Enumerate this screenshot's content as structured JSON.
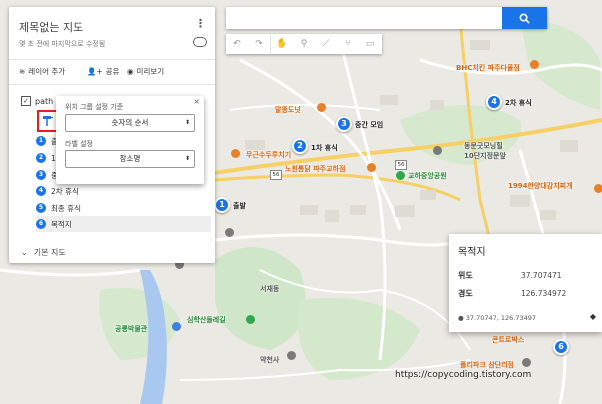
{
  "panel": {
    "title": "제목없는 지도",
    "subtitle": "몇 초 전에 마지막으로 수정됨",
    "add_layer": "레이어 추가",
    "share": "공유",
    "preview": "미리보기",
    "layer_name": "path",
    "items": [
      {
        "num": "1",
        "label": "출"
      },
      {
        "num": "2",
        "label": "1"
      },
      {
        "num": "3",
        "label": "중"
      },
      {
        "num": "4",
        "label": "2차 휴식"
      },
      {
        "num": "5",
        "label": "최종 휴식"
      },
      {
        "num": "6",
        "label": "목적지"
      }
    ],
    "base_map": "기본 지도"
  },
  "style_popup": {
    "group_label": "위치 그룹 설정 기준",
    "group_value": "숫자의 순서",
    "label_label": "라벨 설정",
    "label_value": "장소명"
  },
  "markers": [
    {
      "num": "1",
      "label": "출발"
    },
    {
      "num": "2",
      "label": "1차 휴식"
    },
    {
      "num": "3",
      "label": "중간 모임"
    },
    {
      "num": "4",
      "label": "2차 휴식"
    },
    {
      "num": "6",
      "label": ""
    }
  ],
  "info_card": {
    "title": "목적지",
    "lat_key": "위도",
    "lat_val": "37.707471",
    "lng_key": "경도",
    "lng_val": "126.734972",
    "coords": "37.70747, 126.73497"
  },
  "pois": {
    "bhc": "BHC치킨 파주다율점",
    "malttong": "말똥도넛",
    "mugeun": "무근수두루치기",
    "nowon": "노원통닭 파주교하점",
    "school": "교하중앙공원",
    "dongmun": "동문굿모닝힐",
    "dongmun2": "10단지정문앞",
    "nineteen": "1994한양대감치찌개",
    "seojae": "서재동",
    "museum": "공룡박물관",
    "park": "심학산둘레길",
    "temple": "약천사",
    "polly": "폴리파크 삼단리점",
    "conte": "콘트로박스",
    "road_label": "56"
  },
  "watermark": "https://copycoding.tistory.com"
}
